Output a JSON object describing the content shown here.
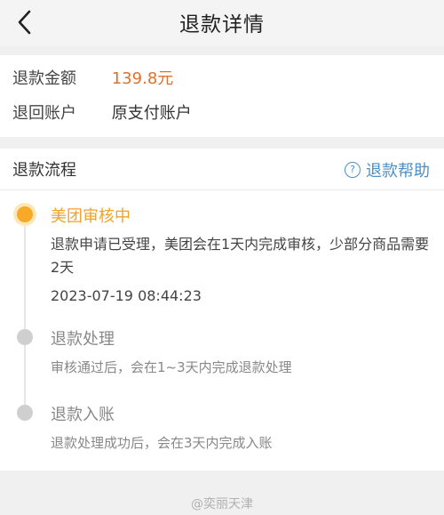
{
  "header": {
    "title": "退款详情"
  },
  "amount_card": {
    "amount_label": "退款金额",
    "amount_value": "139.8元",
    "account_label": "退回账户",
    "account_value": "原支付账户"
  },
  "flow": {
    "title": "退款流程",
    "help_label": "退款帮助",
    "steps": [
      {
        "title": "美团审核中",
        "desc": "退款申请已受理，美团会在1天内完成审核，少部分商品需要2天",
        "time": "2023-07-19 08:44:23",
        "status": "active"
      },
      {
        "title": "退款处理",
        "desc": "审核通过后，会在1~3天内完成退款处理",
        "status": "pending"
      },
      {
        "title": "退款入账",
        "desc": "退款处理成功后，会在3天内完成入账",
        "status": "pending"
      }
    ]
  },
  "watermark": "@奕丽天津",
  "colors": {
    "accent": "#f0a325",
    "money": "#e0712c",
    "link": "#4a8fc8",
    "pending": "#cfcfcf"
  }
}
